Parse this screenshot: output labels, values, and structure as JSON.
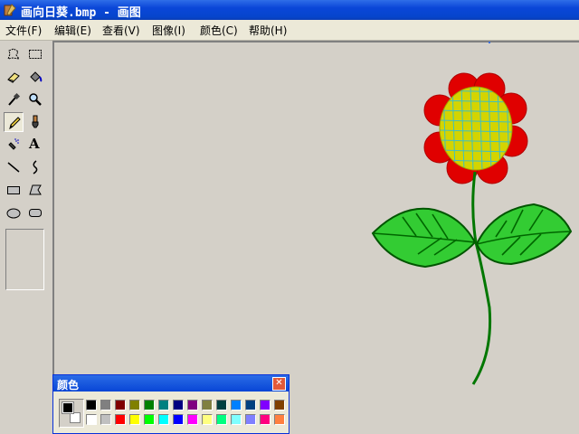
{
  "window": {
    "title": "画向日葵.bmp - 画图"
  },
  "menu": [
    {
      "label": "文件(F)"
    },
    {
      "label": "编辑(E)"
    },
    {
      "label": "查看(V)"
    },
    {
      "label": "图像(I)"
    },
    {
      "label": "颜色(C)"
    },
    {
      "label": "帮助(H)"
    }
  ],
  "tools": [
    {
      "icon": "free-select-icon"
    },
    {
      "icon": "rect-select-icon"
    },
    {
      "icon": "eraser-icon"
    },
    {
      "icon": "fill-icon"
    },
    {
      "icon": "color-picker-icon"
    },
    {
      "icon": "magnifier-icon"
    },
    {
      "icon": "pencil-icon",
      "selected": true
    },
    {
      "icon": "brush-icon"
    },
    {
      "icon": "airbrush-icon"
    },
    {
      "icon": "text-icon",
      "glyph": "A"
    },
    {
      "icon": "line-icon"
    },
    {
      "icon": "curve-icon"
    },
    {
      "icon": "rectangle-icon"
    },
    {
      "icon": "polygon-icon"
    },
    {
      "icon": "ellipse-icon"
    },
    {
      "icon": "rounded-rect-icon"
    }
  ],
  "colors_panel": {
    "title": "颜色",
    "close_glyph": "✕",
    "foreground": "#000000",
    "background": "#ffffff",
    "palette_row1": [
      "#000000",
      "#808080",
      "#800000",
      "#808000",
      "#008000",
      "#008080",
      "#000080",
      "#800080",
      "#808040",
      "#004040",
      "#0080ff",
      "#004080",
      "#8000ff",
      "#804000"
    ],
    "palette_row2": [
      "#ffffff",
      "#c0c0c0",
      "#ff0000",
      "#ffff00",
      "#00ff00",
      "#00ffff",
      "#0000ff",
      "#ff00ff",
      "#ffff80",
      "#00ff80",
      "#80ffff",
      "#8080ff",
      "#ff0080",
      "#ff8040"
    ]
  },
  "drawing": {
    "petal_color": "#e00000",
    "center_color": "#d4d400",
    "grid_color": "#40c0c0",
    "leaf_color": "#33cc33",
    "leaf_vein_color": "#006600",
    "stem_color": "#007700"
  }
}
